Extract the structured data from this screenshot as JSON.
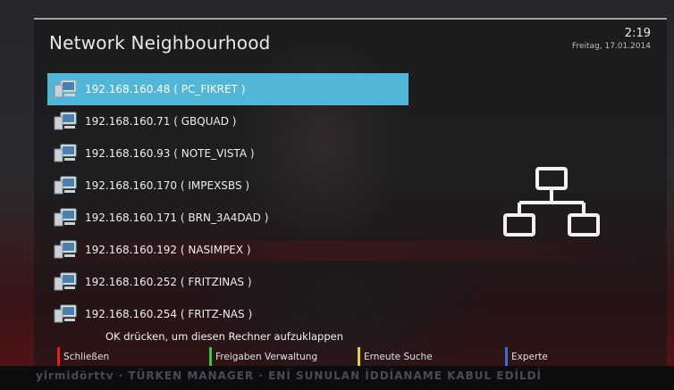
{
  "header": {
    "title": "Network Neighbourhood",
    "time": "2:19",
    "date": "Freitag, 17.01.2014"
  },
  "hosts": [
    {
      "label": "192.168.160.48 ( PC_FIKRET )",
      "selected": true
    },
    {
      "label": "192.168.160.71 ( GBQUAD )",
      "selected": false
    },
    {
      "label": "192.168.160.93 ( NOTE_VISTA )",
      "selected": false
    },
    {
      "label": "192.168.160.170 ( IMPEXSBS )",
      "selected": false
    },
    {
      "label": "192.168.160.171 ( BRN_3A4DAD )",
      "selected": false
    },
    {
      "label": "192.168.160.192 ( NASIMPEX )",
      "selected": false
    },
    {
      "label": "192.168.160.252 ( FRITZINAS )",
      "selected": false
    },
    {
      "label": "192.168.160.254 ( FRITZ-NAS )",
      "selected": false
    }
  ],
  "hint": "OK drücken, um diesen Rechner aufzuklappen",
  "footer": {
    "buttons": [
      {
        "label": "Schließen",
        "color": "#e02020"
      },
      {
        "label": "Freigaben Verwaltung",
        "color": "#3cc83c"
      },
      {
        "label": "Erneute Suche",
        "color": "#e8d23a"
      },
      {
        "label": "Experte",
        "color": "#3a6fe0"
      }
    ]
  },
  "ticker": "yirmidörttv · TÜRKEN MANAGER · ENİ SUNULAN İDDİANAME KABUL EDİLDİ",
  "colors": {
    "selection": "#52b6d7"
  }
}
